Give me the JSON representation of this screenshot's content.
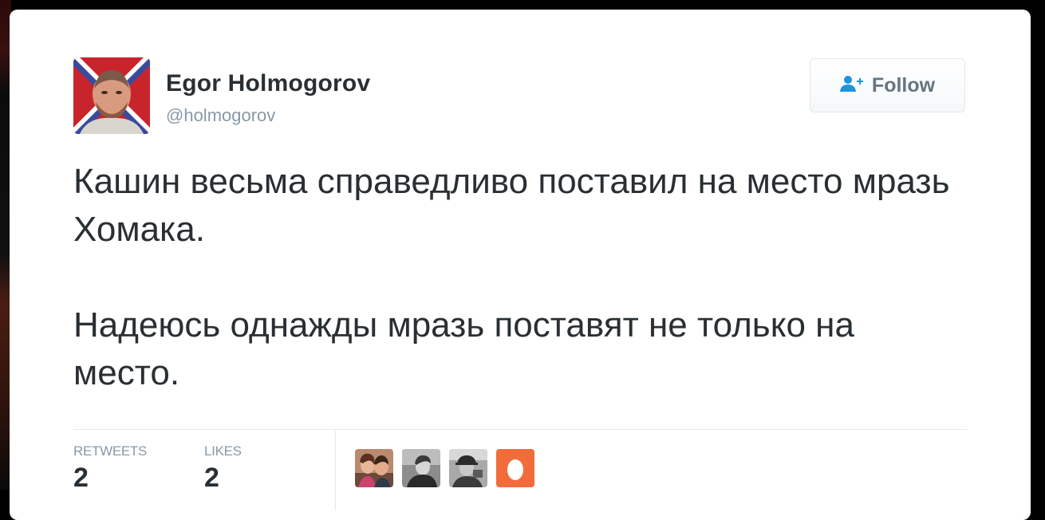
{
  "tweet": {
    "author": {
      "display_name": "Egor Holmogorov",
      "handle": "@holmogorov",
      "avatar_icon": "profile-photo"
    },
    "follow": {
      "label": "Follow",
      "icon": "add-user-icon",
      "icon_color": "#1b95e0"
    },
    "paragraphs": [
      "Кашин весьма справедливо поставил на место мразь Хомака.",
      "Надеюсь однажды мразь поставят не только на место."
    ],
    "stats": {
      "retweets_label": "RETWEETS",
      "retweets_count": "2",
      "likes_label": "LIKES",
      "likes_count": "2"
    },
    "likers": [
      {
        "icon": "liker-avatar-couple"
      },
      {
        "icon": "liker-avatar-man-bw"
      },
      {
        "icon": "liker-avatar-man-hat"
      },
      {
        "icon": "liker-avatar-default-egg",
        "color": "#f26b3a"
      }
    ]
  }
}
